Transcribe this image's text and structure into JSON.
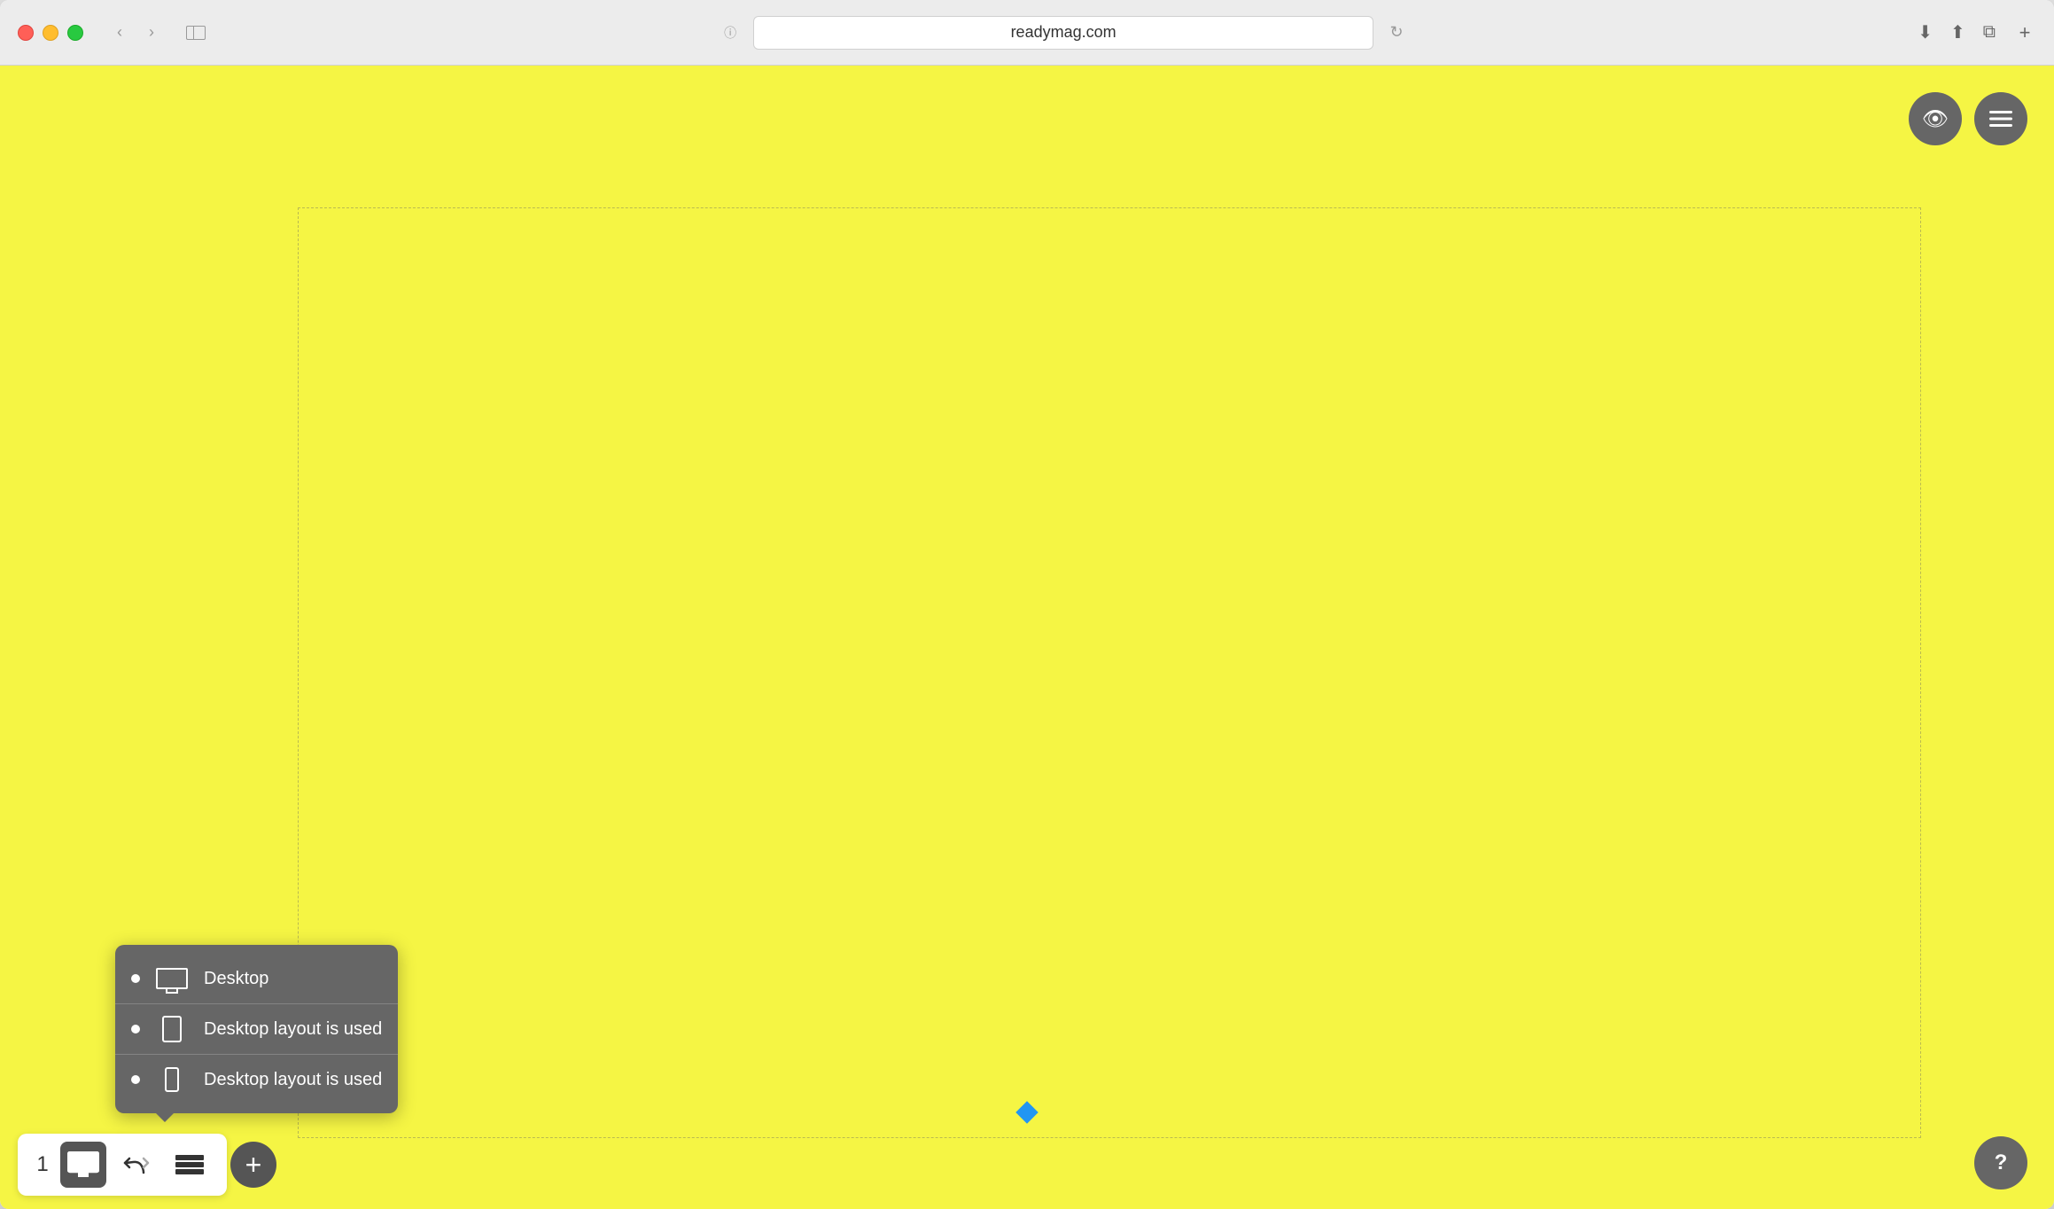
{
  "browser": {
    "url": "readymag.com",
    "tab_plus_label": "+"
  },
  "toolbar": {
    "page_number": "1",
    "desktop_label": "Desktop",
    "undo_redo_label": "↩",
    "layers_label": "Layers",
    "add_label": "+"
  },
  "top_controls": {
    "preview_icon": "👁",
    "menu_icon": "≡"
  },
  "dropdown": {
    "items": [
      {
        "label": "Desktop",
        "has_bullet": true,
        "device": "desktop"
      },
      {
        "label": "Desktop layout is used",
        "has_bullet": true,
        "device": "tablet"
      },
      {
        "label": "Desktop layout is used",
        "has_bullet": true,
        "device": "mobile"
      }
    ]
  },
  "help": {
    "label": "?"
  }
}
